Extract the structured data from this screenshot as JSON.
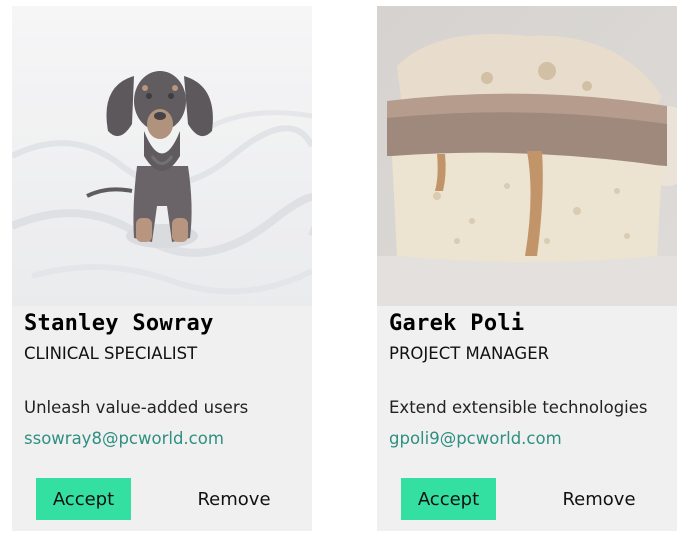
{
  "cards": [
    {
      "photo": "dachshund-dog-on-bed",
      "name": "Stanley Sowray",
      "role": "CLINICAL SPECIALIST",
      "description": "Unleash value-added users",
      "email": "ssowray8@pcworld.com",
      "accept_label": "Accept",
      "remove_label": "Remove"
    },
    {
      "photo": "cut-bread-roll-with-caramel",
      "name": "Garek Poli",
      "role": "PROJECT MANAGER",
      "description": "Extend extensible technologies",
      "email": "gpoli9@pcworld.com",
      "accept_label": "Accept",
      "remove_label": "Remove"
    }
  ],
  "colors": {
    "card_background": "#f0f0f0",
    "accept_button": "#33e0a1",
    "email_link": "#2f8f82"
  }
}
